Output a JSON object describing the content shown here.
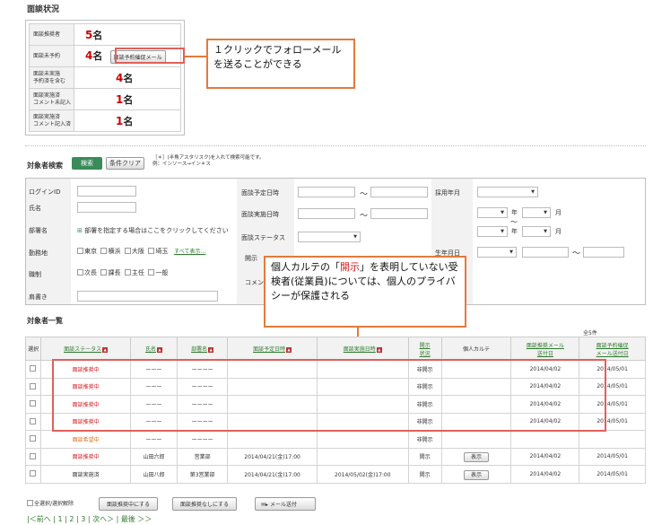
{
  "section1_title": "面談状況",
  "stats": [
    {
      "label": "面談推奨者",
      "num": "5",
      "unit": "名"
    },
    {
      "label": "面談未予約",
      "num": "4",
      "unit": "名",
      "button": "面談予約催促メール"
    },
    {
      "label": "面談未実施\n予約済を含む",
      "num": "4",
      "unit": "名"
    },
    {
      "label": "面談実施済\nコメント未記入",
      "num": "1",
      "unit": "名"
    },
    {
      "label": "面談実施済\nコメント記入済",
      "num": "1",
      "unit": "名"
    }
  ],
  "callout1": "１クリックでフォローメールを送ることができる",
  "search": {
    "title": "対象者検索",
    "search_btn": "検索",
    "clear_btn": "条件クリア",
    "hint1": "［＊］(半角アスタリスク)を入れて検索可能です。",
    "hint2": "例：インソース→イン＊ス",
    "login_id": "ログインID",
    "name": "氏名",
    "dept": "部署名",
    "dept_hint": "部署を指定する場合はここをクリックしてください",
    "workplace": "勤務地",
    "workplaces": [
      "東京",
      "横浜",
      "大阪",
      "埼玉"
    ],
    "show_all": "すべて表示…",
    "position": "職制",
    "positions": [
      "次長",
      "課長",
      "主任",
      "一般"
    ],
    "title_label": "肩書き",
    "planned_date": "面談予定日時",
    "done_date": "面談実施日時",
    "status": "面談ステータス",
    "disclose": "開示",
    "comment": "コメント",
    "hire": "採用年月",
    "year": "年",
    "month": "月",
    "tilde": "〜",
    "birth": "生年月日"
  },
  "callout2": "個人カルテの「開示」を表明していない受検者(従業員)については、個人のプライバシーが保護される",
  "callout2_emph": "開示",
  "list": {
    "title": "対象者一覧",
    "count": "全5件",
    "headers": [
      "選択",
      "面談ステータス",
      "氏名",
      "部署名",
      "面談予定日時",
      "面談実施日時",
      "開示\n状況",
      "個人カルテ",
      "面談推奨メール\n送付日",
      "面談予約催促\nメール送付日"
    ],
    "rows": [
      {
        "status": "面談推奨中",
        "scls": "red",
        "name": "ーーー",
        "dept": "ーーーー",
        "plan": "",
        "done": "",
        "disc": "非開示",
        "karte": "",
        "m1": "2014/04/02",
        "m2": "2014/05/01"
      },
      {
        "status": "面談推奨中",
        "scls": "red",
        "name": "ーーー",
        "dept": "ーーーー",
        "plan": "",
        "done": "",
        "disc": "非開示",
        "karte": "",
        "m1": "2014/04/02",
        "m2": "2014/05/01"
      },
      {
        "status": "面談推奨中",
        "scls": "red",
        "name": "ーーー",
        "dept": "ーーーー",
        "plan": "",
        "done": "",
        "disc": "非開示",
        "karte": "",
        "m1": "2014/04/02",
        "m2": "2014/05/01"
      },
      {
        "status": "面談推奨中",
        "scls": "red",
        "name": "ーーー",
        "dept": "ーーーー",
        "plan": "",
        "done": "",
        "disc": "非開示",
        "karte": "",
        "m1": "2014/04/02",
        "m2": "2014/05/01"
      },
      {
        "status": "面談希望中",
        "scls": "orange",
        "name": "ーーー",
        "dept": "ーーーー",
        "plan": "",
        "done": "",
        "disc": "非開示",
        "karte": "",
        "m1": "",
        "m2": ""
      },
      {
        "status": "面談推奨中",
        "scls": "red",
        "name": "山田六郎",
        "dept": "営業部",
        "plan": "2014/04/21(金)17:00",
        "done": "",
        "disc": "開示",
        "karte": "表示",
        "m1": "2014/04/02",
        "m2": "2014/05/01"
      },
      {
        "status": "面談実施済",
        "scls": "",
        "name": "山田八郎",
        "dept": "第3営業部",
        "plan": "2014/04/21(金)17:00",
        "done": "2014/05/02(金)17:00",
        "disc": "開示",
        "karte": "表示",
        "m1": "2014/04/02",
        "m2": "2014/05/01"
      }
    ]
  },
  "footer": {
    "select_all": "全選択/選択解除",
    "btn1": "面談推奨中にする",
    "btn2": "面談推奨なしにする",
    "btn3": "メール送付",
    "pager": "|＜前へ | 1 | 2 | 3 | 次へ＞ | 最後 ＞＞"
  },
  "colors": {
    "accent": "#e47a3c",
    "green_btn": "#3a8a5a",
    "status_red": "#d02020",
    "status_orange": "#e07020"
  }
}
